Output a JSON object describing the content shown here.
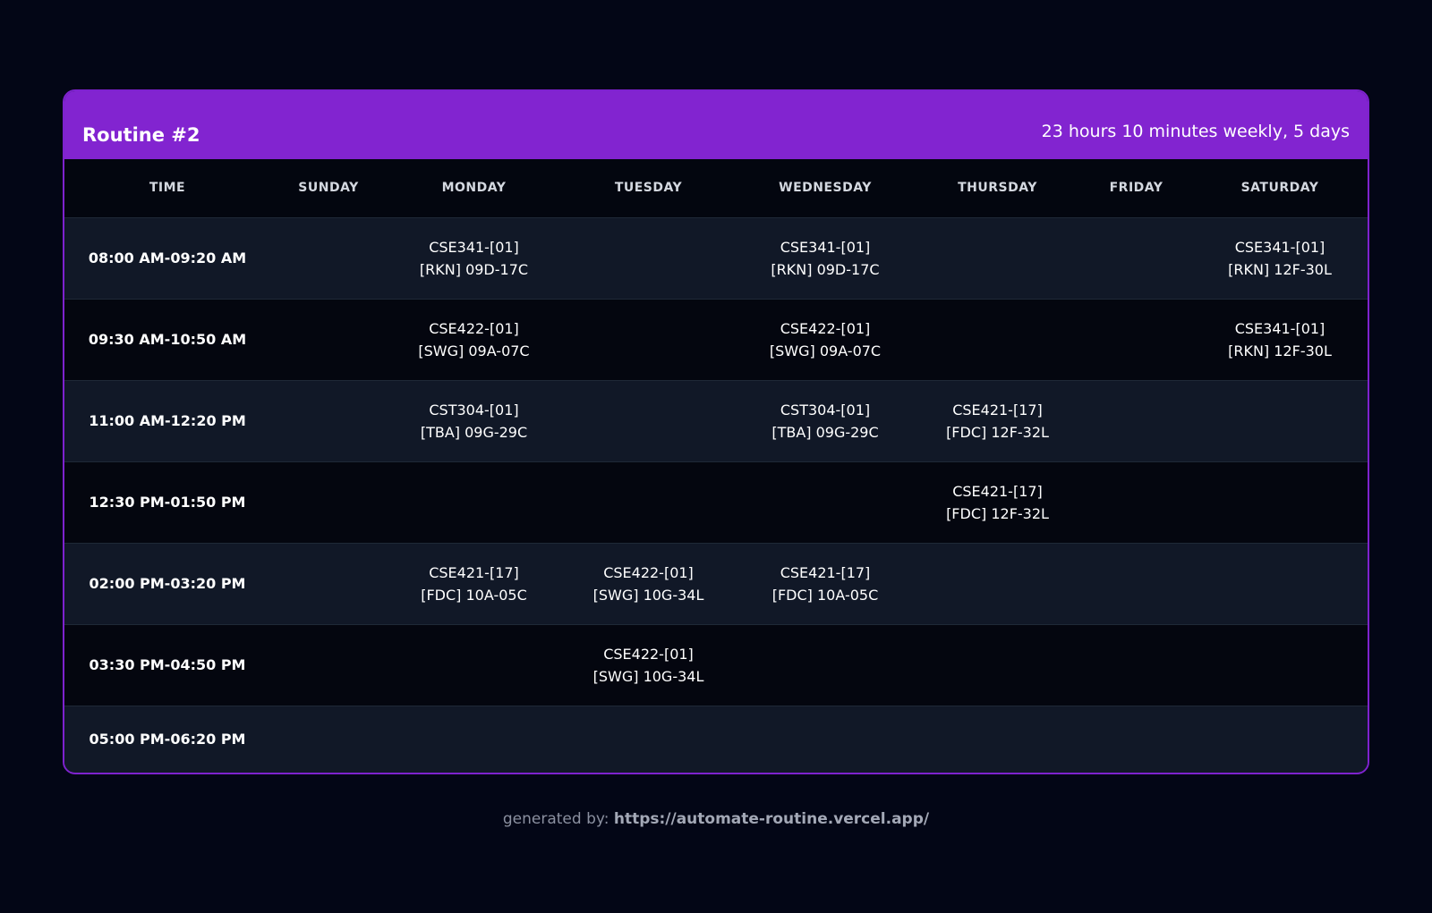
{
  "card": {
    "title": "Routine #2",
    "subtitle": "23 hours 10 minutes weekly, 5 days"
  },
  "columns": [
    "TIME",
    "SUNDAY",
    "MONDAY",
    "TUESDAY",
    "WEDNESDAY",
    "THURSDAY",
    "FRIDAY",
    "SATURDAY"
  ],
  "rows": [
    {
      "time": "08:00 AM-09:20 AM",
      "cells": [
        [
          "",
          ""
        ],
        [
          "CSE341-[01]",
          "[RKN] 09D-17C"
        ],
        [
          "",
          ""
        ],
        [
          "CSE341-[01]",
          "[RKN] 09D-17C"
        ],
        [
          "",
          ""
        ],
        [
          "",
          ""
        ],
        [
          "CSE341-[01]",
          "[RKN] 12F-30L"
        ]
      ]
    },
    {
      "time": "09:30 AM-10:50 AM",
      "cells": [
        [
          "",
          ""
        ],
        [
          "CSE422-[01]",
          "[SWG] 09A-07C"
        ],
        [
          "",
          ""
        ],
        [
          "CSE422-[01]",
          "[SWG] 09A-07C"
        ],
        [
          "",
          ""
        ],
        [
          "",
          ""
        ],
        [
          "CSE341-[01]",
          "[RKN] 12F-30L"
        ]
      ]
    },
    {
      "time": "11:00 AM-12:20 PM",
      "cells": [
        [
          "",
          ""
        ],
        [
          "CST304-[01]",
          "[TBA] 09G-29C"
        ],
        [
          "",
          ""
        ],
        [
          "CST304-[01]",
          "[TBA] 09G-29C"
        ],
        [
          "CSE421-[17]",
          "[FDC] 12F-32L"
        ],
        [
          "",
          ""
        ],
        [
          "",
          ""
        ]
      ]
    },
    {
      "time": "12:30 PM-01:50 PM",
      "cells": [
        [
          "",
          ""
        ],
        [
          "",
          ""
        ],
        [
          "",
          ""
        ],
        [
          "",
          ""
        ],
        [
          "CSE421-[17]",
          "[FDC] 12F-32L"
        ],
        [
          "",
          ""
        ],
        [
          "",
          ""
        ]
      ]
    },
    {
      "time": "02:00 PM-03:20 PM",
      "cells": [
        [
          "",
          ""
        ],
        [
          "CSE421-[17]",
          "[FDC] 10A-05C"
        ],
        [
          "CSE422-[01]",
          "[SWG] 10G-34L"
        ],
        [
          "CSE421-[17]",
          "[FDC] 10A-05C"
        ],
        [
          "",
          ""
        ],
        [
          "",
          ""
        ],
        [
          "",
          ""
        ]
      ]
    },
    {
      "time": "03:30 PM-04:50 PM",
      "cells": [
        [
          "",
          ""
        ],
        [
          "",
          ""
        ],
        [
          "CSE422-[01]",
          "[SWG] 10G-34L"
        ],
        [
          "",
          ""
        ],
        [
          "",
          ""
        ],
        [
          "",
          ""
        ],
        [
          "",
          ""
        ]
      ]
    },
    {
      "time": "05:00 PM-06:20 PM",
      "cells": [
        [
          "",
          ""
        ],
        [
          "",
          ""
        ],
        [
          "",
          ""
        ],
        [
          "",
          ""
        ],
        [
          "",
          ""
        ],
        [
          "",
          ""
        ],
        [
          "",
          ""
        ]
      ]
    }
  ],
  "footer": {
    "prefix": "generated by:",
    "link": "https://automate-routine.vercel.app/"
  },
  "colors": {
    "background": "#030616",
    "header_purple": "#8224d0",
    "border_purple": "#7e22ce",
    "row_dark": "#04060f",
    "row_light": "#111827"
  }
}
